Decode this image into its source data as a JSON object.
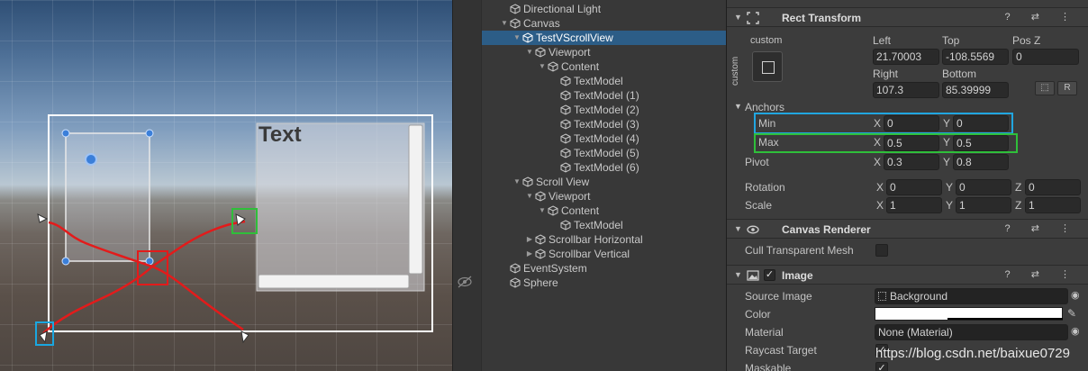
{
  "scene": {
    "text_label": "Text",
    "annotation_colors": {
      "red": "#e31b1b",
      "blue": "#1aa7e0",
      "green": "#2fbf3a"
    }
  },
  "hierarchy": {
    "items": [
      {
        "label": "Directional Light",
        "depth": 1,
        "arrow": ""
      },
      {
        "label": "Canvas",
        "depth": 1,
        "arrow": "▼"
      },
      {
        "label": "TestVScrollView",
        "depth": 2,
        "arrow": "▼",
        "selected": true
      },
      {
        "label": "Viewport",
        "depth": 3,
        "arrow": "▼"
      },
      {
        "label": "Content",
        "depth": 4,
        "arrow": "▼"
      },
      {
        "label": "TextModel",
        "depth": 5,
        "arrow": ""
      },
      {
        "label": "TextModel (1)",
        "depth": 5,
        "arrow": ""
      },
      {
        "label": "TextModel (2)",
        "depth": 5,
        "arrow": ""
      },
      {
        "label": "TextModel (3)",
        "depth": 5,
        "arrow": ""
      },
      {
        "label": "TextModel (4)",
        "depth": 5,
        "arrow": ""
      },
      {
        "label": "TextModel (5)",
        "depth": 5,
        "arrow": ""
      },
      {
        "label": "TextModel (6)",
        "depth": 5,
        "arrow": ""
      },
      {
        "label": "Scroll View",
        "depth": 2,
        "arrow": "▼"
      },
      {
        "label": "Viewport",
        "depth": 3,
        "arrow": "▼"
      },
      {
        "label": "Content",
        "depth": 4,
        "arrow": "▼"
      },
      {
        "label": "TextModel",
        "depth": 5,
        "arrow": ""
      },
      {
        "label": "Scrollbar Horizontal",
        "depth": 3,
        "arrow": "▶"
      },
      {
        "label": "Scrollbar Vertical",
        "depth": 3,
        "arrow": "▶"
      },
      {
        "label": "EventSystem",
        "depth": 1,
        "arrow": ""
      },
      {
        "label": "Sphere",
        "depth": 1,
        "arrow": ""
      }
    ]
  },
  "inspector": {
    "rect_transform": {
      "title": "Rect Transform",
      "anchor_preset_label": "custom",
      "anchor_preset_side_label": "custom",
      "left_label": "Left",
      "left": "21.70003",
      "top_label": "Top",
      "top": "-108.5569",
      "posz_label": "Pos Z",
      "posz": "0",
      "right_label": "Right",
      "right": "107.3",
      "bottom_label": "Bottom",
      "bottom": "85.39999",
      "blueprint_btn": "⬚",
      "raw_btn": "R",
      "anchors_label": "Anchors",
      "min_label": "Min",
      "min_x": "0",
      "min_y": "0",
      "max_label": "Max",
      "max_x": "0.5",
      "max_y": "0.5",
      "pivot_label": "Pivot",
      "pivot_x": "0.3",
      "pivot_y": "0.8",
      "rotation_label": "Rotation",
      "rot_x": "0",
      "rot_y": "0",
      "rot_z": "0",
      "scale_label": "Scale",
      "scale_x": "1",
      "scale_y": "1",
      "scale_z": "1",
      "axis_x": "X",
      "axis_y": "Y",
      "axis_z": "Z"
    },
    "canvas_renderer": {
      "title": "Canvas Renderer",
      "cull_label": "Cull Transparent Mesh"
    },
    "image": {
      "title": "Image",
      "source_label": "Source Image",
      "source_value": "Background",
      "color_label": "Color",
      "material_label": "Material",
      "material_value": "None (Material)",
      "raycast_label": "Raycast Target",
      "maskable_label": "Maskable"
    },
    "tools": "? ⇄ ⋮"
  },
  "watermark": "https://blog.csdn.net/baixue0729"
}
